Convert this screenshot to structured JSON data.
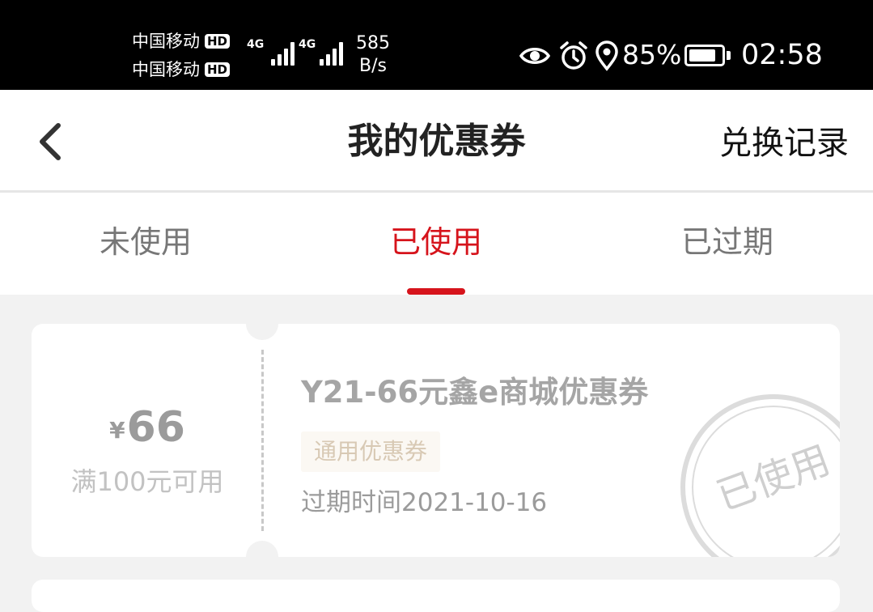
{
  "status_bar": {
    "carrier_1": "中国移动",
    "carrier_2": "中国移动",
    "hd_badge": "HD",
    "network_1": "4G",
    "network_2": "4G",
    "speed_value": "585",
    "speed_unit": "B/s",
    "battery_percent": "85%",
    "battery_level": 0.85,
    "time": "02:58",
    "icons": [
      "eye-icon",
      "alarm-icon",
      "location-icon",
      "battery-icon"
    ]
  },
  "header": {
    "title": "我的优惠券",
    "action_label": "兑换记录"
  },
  "tabs": {
    "items": [
      {
        "label": "未使用"
      },
      {
        "label": "已使用"
      },
      {
        "label": "已过期"
      }
    ],
    "active_index": 1
  },
  "coupon": {
    "currency_symbol": "¥",
    "amount": "66",
    "condition": "满100元可用",
    "name": "Y21-66元鑫e商城优惠券",
    "tag": "通用优惠券",
    "expiry": "过期时间2021-10-16",
    "stamp": "已使用"
  },
  "colors": {
    "accent": "#d6141c",
    "status_bar_bg": "#000000",
    "page_bg": "#f2f2f2",
    "muted_text": "#9b9b9b",
    "tag_bg": "#fbf8f3",
    "tag_text": "#d8c9b4"
  }
}
